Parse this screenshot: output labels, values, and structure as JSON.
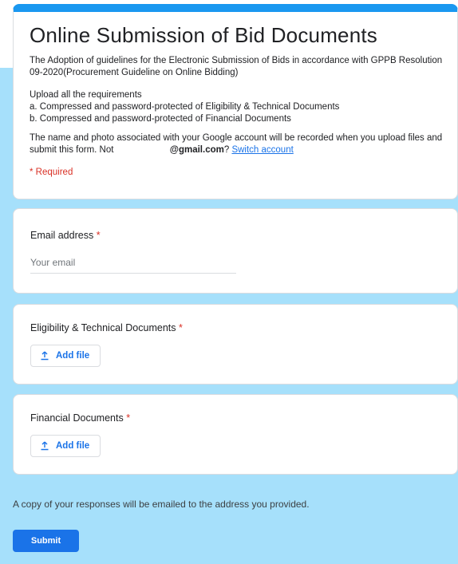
{
  "form": {
    "title": "Online Submission of Bid Documents",
    "description_line1": "The Adoption of guidelines for the Electronic Submission of Bids in accordance with GPPB Resolution 09-2020(Procurement Guideline on Online Bidding)",
    "requirements_heading": "Upload all the requirements",
    "requirement_a": "a. Compressed and password-protected of Eligibility & Technical Documents",
    "requirement_b": "b.  Compressed and password-protected of Financial Documents",
    "account_notice_prefix": "The name and photo associated with your Google account will be recorded when you upload files and submit this form. Not ",
    "account_email": "@gmail.com",
    "account_notice_suffix": "?",
    "switch_account_label": "Switch account",
    "required_note": "* Required"
  },
  "questions": {
    "email": {
      "label": "Email address",
      "required_mark": "*",
      "placeholder": "Your email"
    },
    "eligibility": {
      "label": "Eligibility & Technical Documents",
      "required_mark": "*",
      "button_label": "Add file"
    },
    "financial": {
      "label": "Financial Documents",
      "required_mark": "*",
      "button_label": "Add file"
    }
  },
  "footer": {
    "copy_notice": "A copy of your responses will be emailed to the address you provided.",
    "submit_label": "Submit"
  },
  "colors": {
    "accent": "#1a73e8",
    "header_bar": "#1a98f0",
    "background": "#a6e0fb",
    "required": "#d93025"
  },
  "icons": {
    "add_file": "upload-icon"
  }
}
